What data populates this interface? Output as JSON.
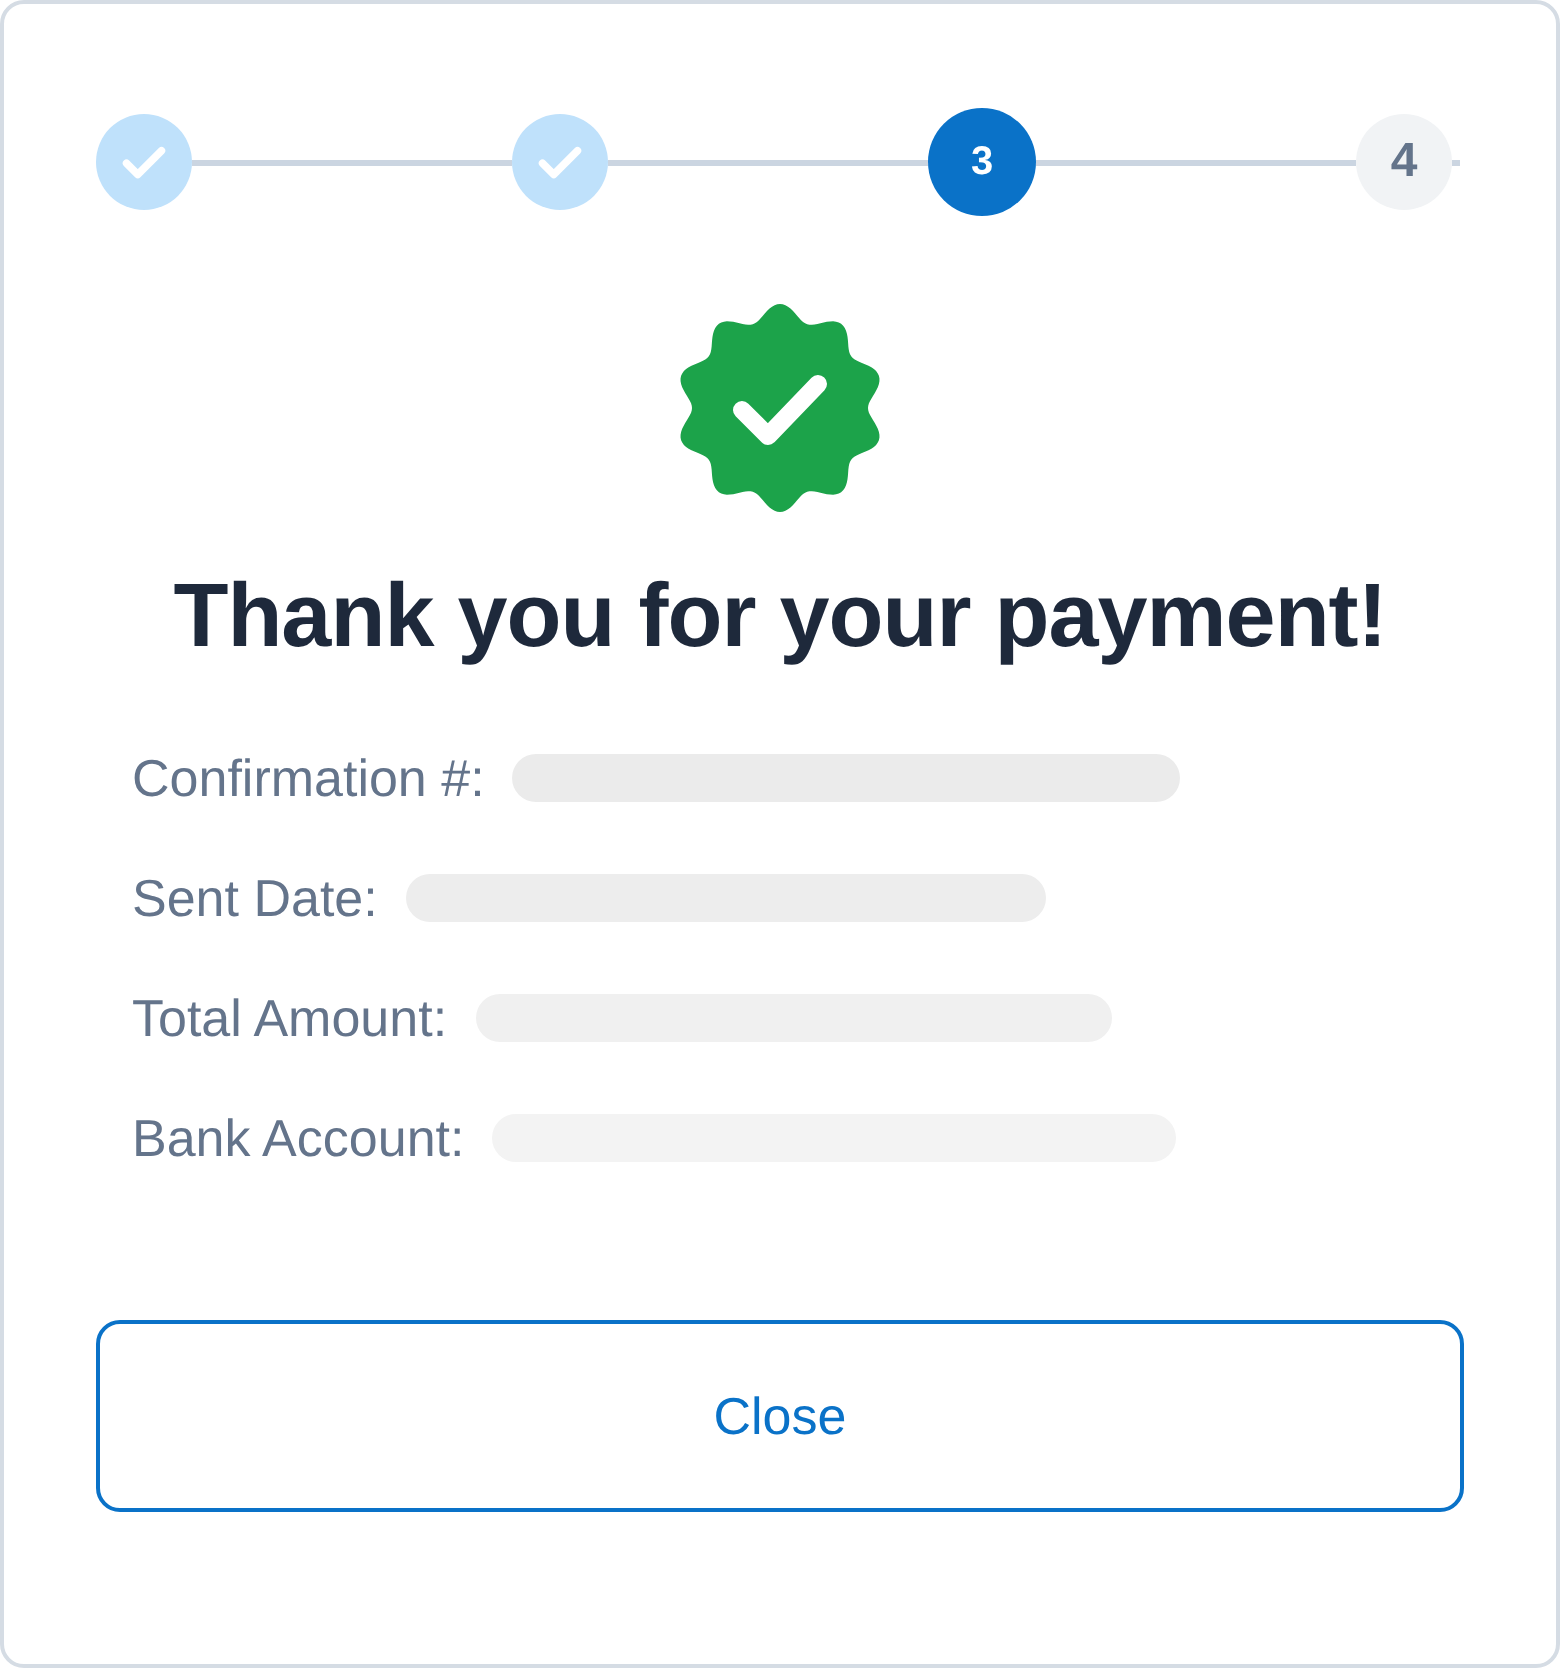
{
  "stepper": [
    {
      "kind": "done"
    },
    {
      "kind": "done"
    },
    {
      "kind": "current",
      "label": "3"
    },
    {
      "kind": "upcoming",
      "label": "4"
    }
  ],
  "heading": "Thank you for your payment!",
  "details": [
    {
      "label": "Confirmation #:"
    },
    {
      "label": "Sent Date:"
    },
    {
      "label": "Total Amount:"
    },
    {
      "label": "Bank Account:"
    }
  ],
  "close_button": "Close"
}
